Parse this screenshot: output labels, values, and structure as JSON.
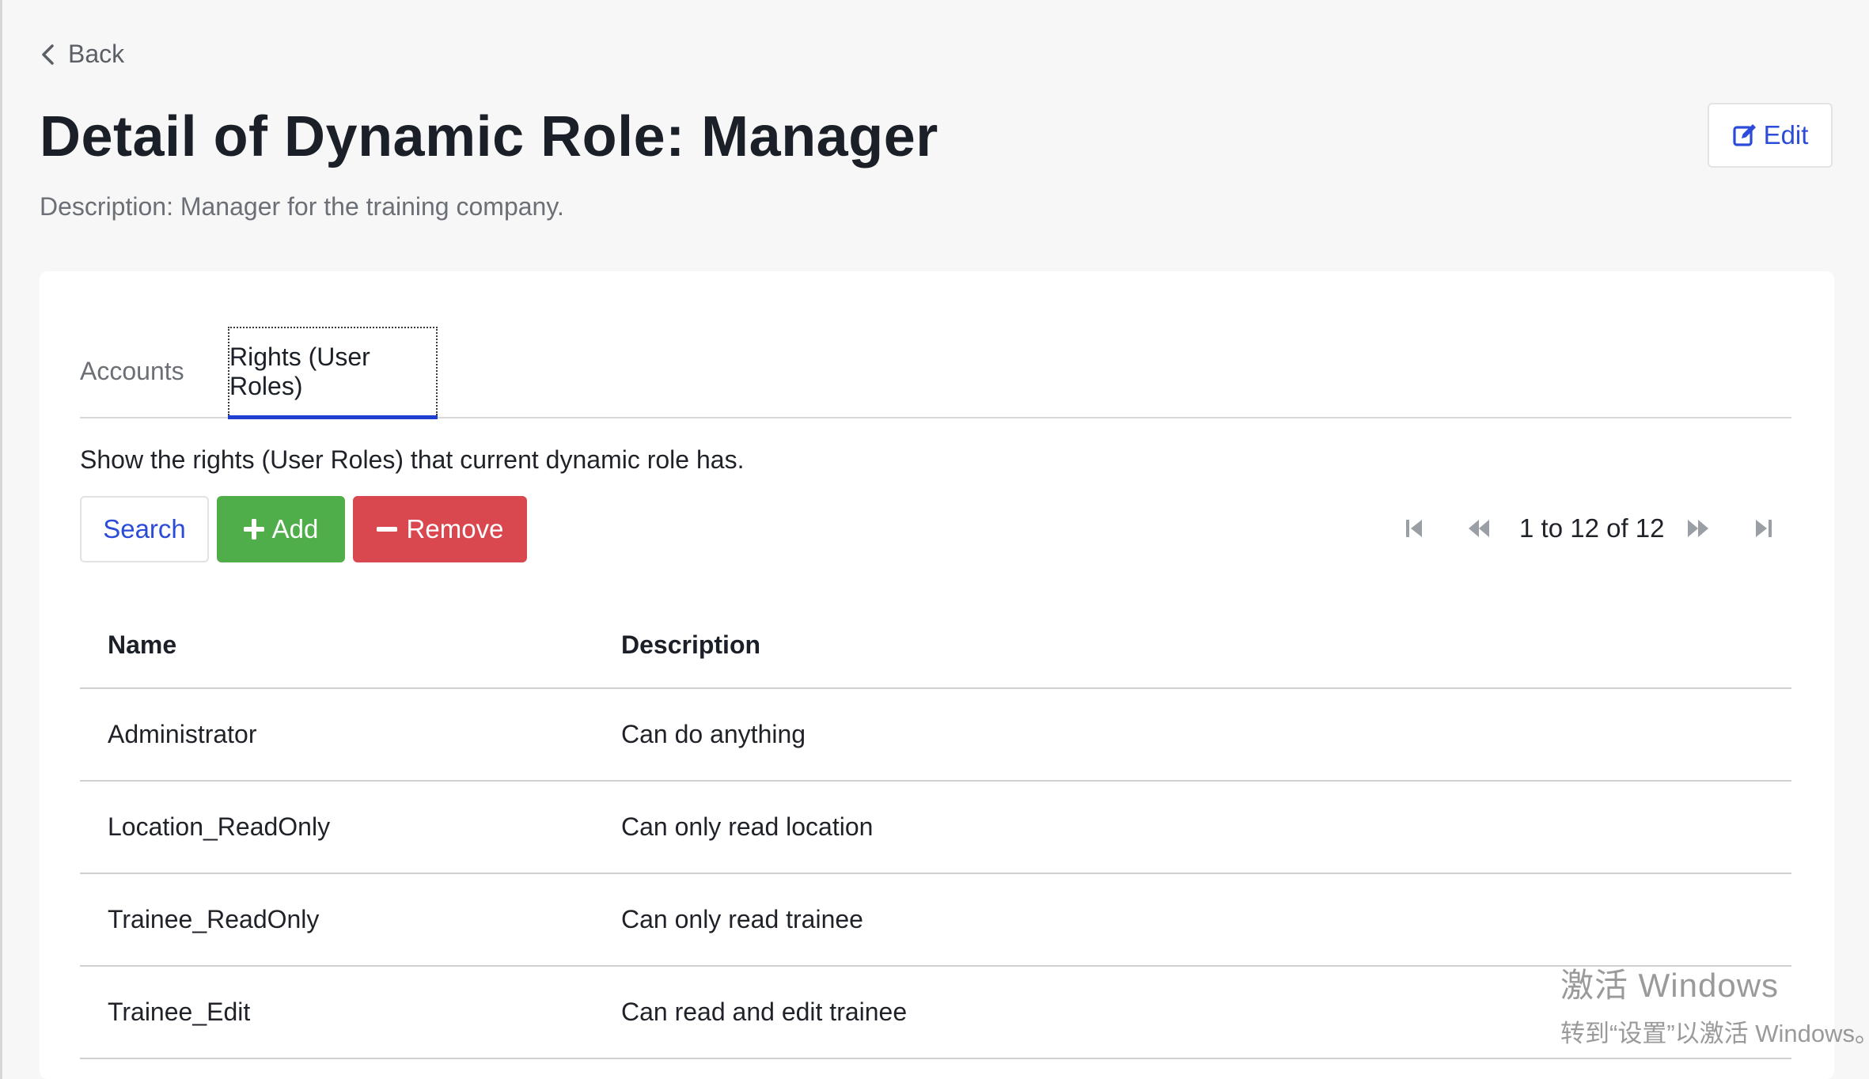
{
  "nav": {
    "back_label": "Back"
  },
  "header": {
    "title": "Detail of Dynamic Role: Manager",
    "description": "Description: Manager for the training company.",
    "edit_label": "Edit"
  },
  "tabs": [
    {
      "label": "Accounts",
      "active": false
    },
    {
      "label": "Rights (User Roles)",
      "active": true
    }
  ],
  "section": {
    "description": "Show the rights (User Roles) that current dynamic role has."
  },
  "toolbar": {
    "search_label": "Search",
    "add_label": "Add",
    "remove_label": "Remove"
  },
  "pagination": {
    "text": "1 to 12 of 12"
  },
  "table": {
    "columns": [
      "Name",
      "Description"
    ],
    "rows": [
      {
        "name": "Administrator",
        "description": "Can do anything"
      },
      {
        "name": "Location_ReadOnly",
        "description": "Can only read location"
      },
      {
        "name": "Trainee_ReadOnly",
        "description": "Can only read trainee"
      },
      {
        "name": "Trainee_Edit",
        "description": "Can read and edit trainee"
      }
    ]
  },
  "watermark": {
    "title": "激活 Windows",
    "subtitle": "转到“设置”以激活 Windows。"
  },
  "colors": {
    "accent": "#2c4bd8",
    "add": "#4fad4a",
    "remove": "#d9474f",
    "tab_underline": "#1f3fce"
  }
}
